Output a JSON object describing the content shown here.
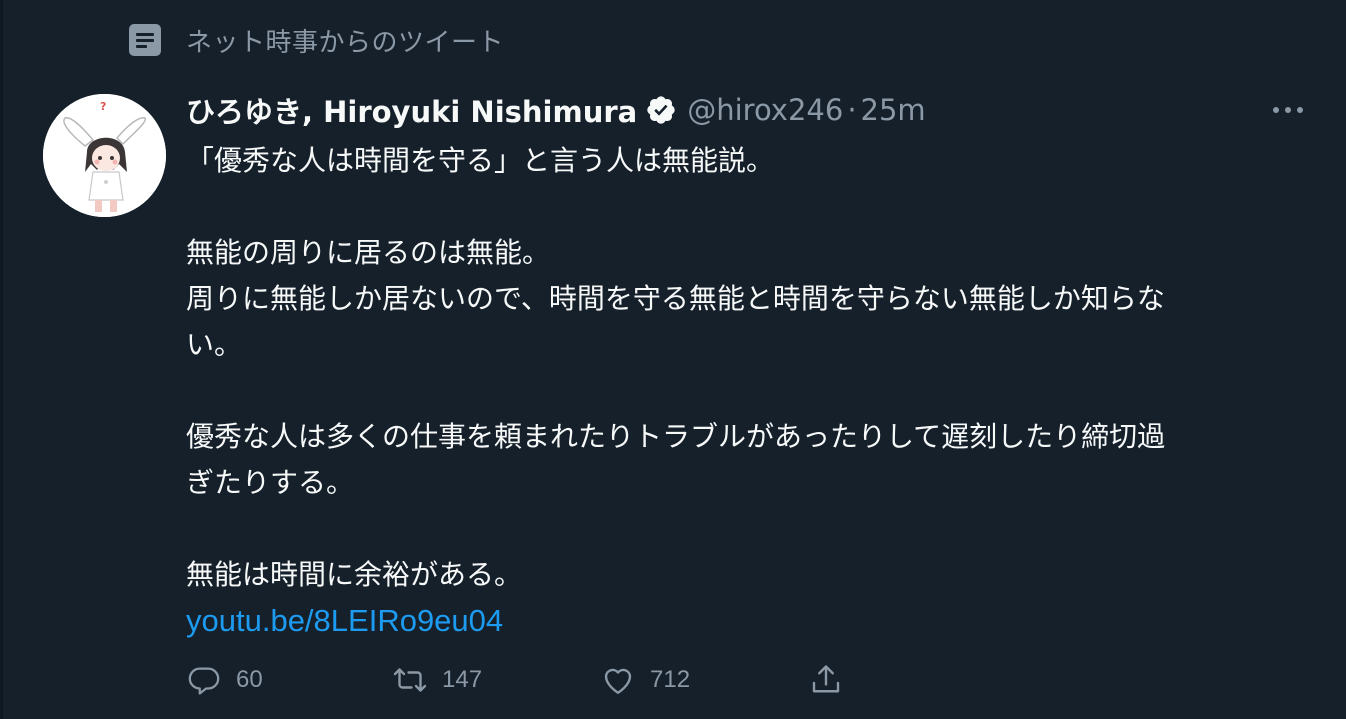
{
  "context": {
    "icon": "article-icon",
    "text": "ネット時事からのツイート"
  },
  "tweet": {
    "display_name": "ひろゆき, Hiroyuki Nishimura",
    "verified": true,
    "handle": "@hirox246",
    "separator": "·",
    "time": "25m",
    "lines": [
      "「優秀な人は時間を守る」と言う人は無能説。",
      "",
      "無能の周りに居るのは無能。",
      "周りに無能しか居ないので、時間を守る無能と時間を守らない無能しか知らな",
      "い。",
      "",
      "優秀な人は多くの仕事を頼まれたりトラブルがあったりして遅刻したり締切過",
      "ぎたりする。",
      "",
      "無能は時間に余裕がある。"
    ],
    "link": "youtu.be/8LEIRo9eu04"
  },
  "actions": {
    "reply_count": "60",
    "retweet_count": "147",
    "like_count": "712"
  },
  "colors": {
    "background": "#15202b",
    "text_primary": "#f7f9f9",
    "text_secondary": "#8b98a5",
    "link": "#1d9bf0"
  }
}
